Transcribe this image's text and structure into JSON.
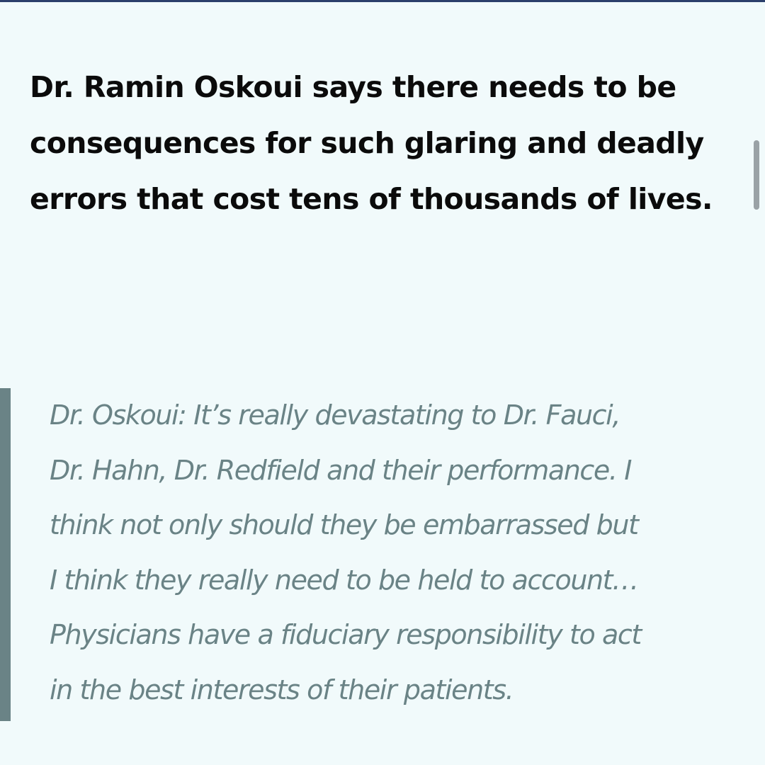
{
  "colors": {
    "background": "#f1fafb",
    "headline_text": "#0b0b0b",
    "quote_text": "#6a8386",
    "quote_bar": "#6a8386",
    "top_rule": "#2b3f6b",
    "scrollbar_thumb": "#8b9296"
  },
  "article": {
    "headline": "Dr. Ramin Oskoui says there needs to be consequences for such glaring and deadly errors that cost tens of thousands of lives.",
    "quote": "Dr. Oskoui: It’s really devastating to Dr. Fauci,\nDr. Hahn, Dr. Redfield and their performance.  I\nthink not only should they be embarrassed but\nI think they really need to be held to account…\nPhysicians have a fiduciary responsibility to act\nin the best interests of their patients."
  }
}
